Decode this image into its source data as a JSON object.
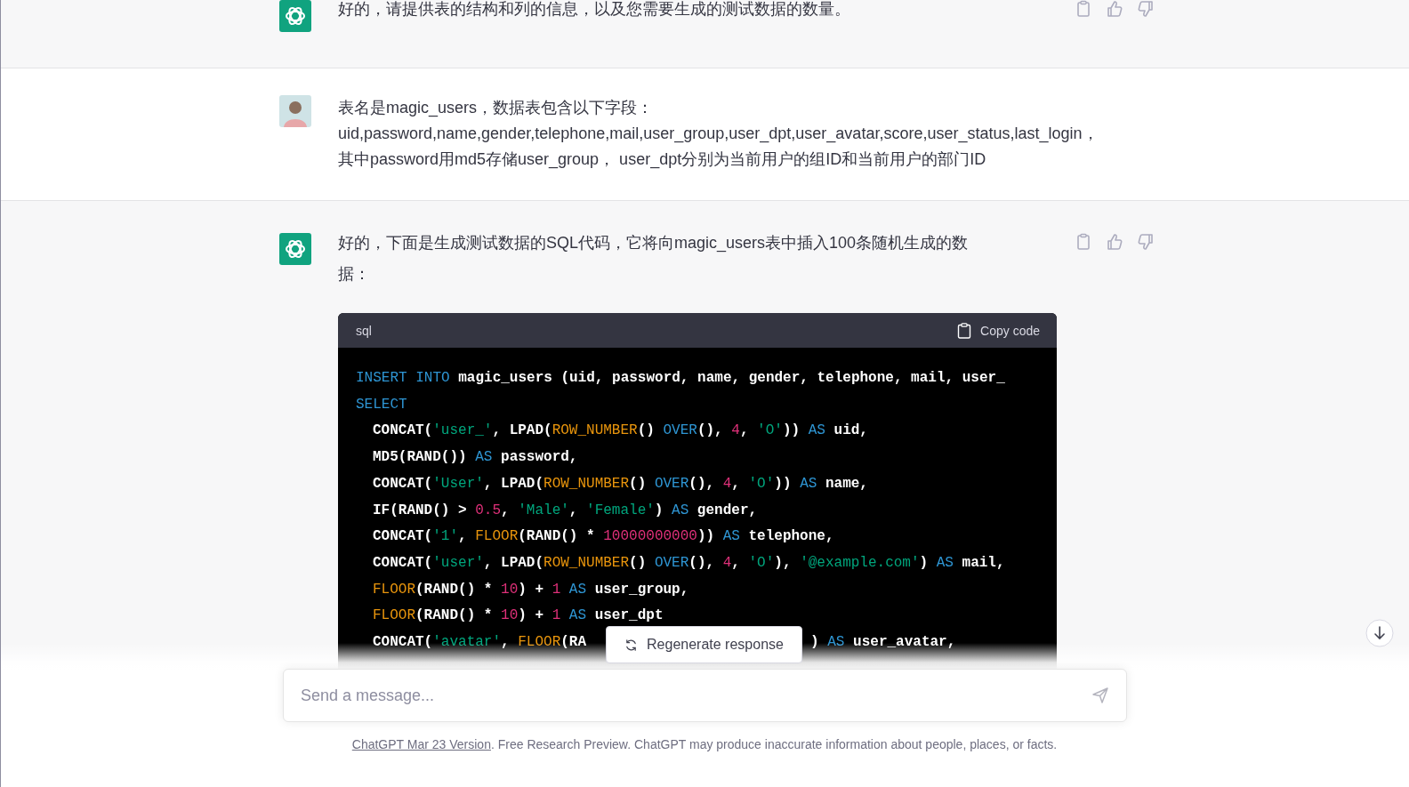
{
  "messages": [
    {
      "kind": "assistant",
      "lines": [
        "好的，请提供表的结构和列的信息，以及您需要生成的测试数据的数量。"
      ]
    },
    {
      "kind": "user",
      "lines": [
        "表名是magic_users，数据表包含以下字段：",
        "uid,password,name,gender,telephone,mail,user_group,user_dpt,user_avatar,score,user_status,last_login，",
        "其中password用md5存储user_group， user_dpt分别为当前用户的组ID和当前用户的部门ID"
      ]
    },
    {
      "kind": "assistant",
      "lines": [
        "好的，下面是生成测试数据的SQL代码，它将向magic_users表中插入100条随机生成的数据："
      ],
      "code": {
        "language": "sql",
        "copy_label": "Copy code",
        "lines": [
          {
            "indent": false,
            "tokens": [
              {
                "kind": "kw",
                "t": "INSERT INTO"
              },
              {
                "kind": "plain",
                "t": " magic_users (uid, password, name, gender, telephone, mail, user_"
              }
            ]
          },
          {
            "indent": false,
            "tokens": [
              {
                "kind": "kw",
                "t": "SELECT"
              }
            ]
          },
          {
            "indent": true,
            "tokens": [
              {
                "kind": "plain",
                "t": "CONCAT("
              },
              {
                "kind": "str",
                "t": "'user_'"
              },
              {
                "kind": "plain",
                "t": ", LPAD("
              },
              {
                "kind": "fn",
                "t": "ROW_NUMBER"
              },
              {
                "kind": "plain",
                "t": "() "
              },
              {
                "kind": "kw",
                "t": "OVER"
              },
              {
                "kind": "plain",
                "t": "(), "
              },
              {
                "kind": "num",
                "t": "4"
              },
              {
                "kind": "plain",
                "t": ", "
              },
              {
                "kind": "str",
                "t": "'O'"
              },
              {
                "kind": "plain",
                "t": ")) "
              },
              {
                "kind": "kw",
                "t": "AS"
              },
              {
                "kind": "plain",
                "t": " uid,"
              }
            ]
          },
          {
            "indent": true,
            "tokens": [
              {
                "kind": "plain",
                "t": "MD5(RAND()) "
              },
              {
                "kind": "kw",
                "t": "AS"
              },
              {
                "kind": "plain",
                "t": " password,"
              }
            ]
          },
          {
            "indent": true,
            "tokens": [
              {
                "kind": "plain",
                "t": "CONCAT("
              },
              {
                "kind": "str",
                "t": "'User'"
              },
              {
                "kind": "plain",
                "t": ", LPAD("
              },
              {
                "kind": "fn",
                "t": "ROW_NUMBER"
              },
              {
                "kind": "plain",
                "t": "() "
              },
              {
                "kind": "kw",
                "t": "OVER"
              },
              {
                "kind": "plain",
                "t": "(), "
              },
              {
                "kind": "num",
                "t": "4"
              },
              {
                "kind": "plain",
                "t": ", "
              },
              {
                "kind": "str",
                "t": "'O'"
              },
              {
                "kind": "plain",
                "t": ")) "
              },
              {
                "kind": "kw",
                "t": "AS"
              },
              {
                "kind": "plain",
                "t": " name,"
              }
            ]
          },
          {
            "indent": true,
            "tokens": [
              {
                "kind": "plain",
                "t": "IF(RAND() > "
              },
              {
                "kind": "num",
                "t": "0.5"
              },
              {
                "kind": "plain",
                "t": ", "
              },
              {
                "kind": "str",
                "t": "'Male'"
              },
              {
                "kind": "plain",
                "t": ", "
              },
              {
                "kind": "str",
                "t": "'Female'"
              },
              {
                "kind": "plain",
                "t": ") "
              },
              {
                "kind": "kw",
                "t": "AS"
              },
              {
                "kind": "plain",
                "t": " gender,"
              }
            ]
          },
          {
            "indent": true,
            "tokens": [
              {
                "kind": "plain",
                "t": "CONCAT("
              },
              {
                "kind": "str",
                "t": "'1'"
              },
              {
                "kind": "plain",
                "t": ", "
              },
              {
                "kind": "fn",
                "t": "FLOOR"
              },
              {
                "kind": "plain",
                "t": "(RAND() * "
              },
              {
                "kind": "num",
                "t": "10000000000"
              },
              {
                "kind": "plain",
                "t": ")) "
              },
              {
                "kind": "kw",
                "t": "AS"
              },
              {
                "kind": "plain",
                "t": " telephone,"
              }
            ]
          },
          {
            "indent": true,
            "tokens": [
              {
                "kind": "plain",
                "t": "CONCAT("
              },
              {
                "kind": "str",
                "t": "'user'"
              },
              {
                "kind": "plain",
                "t": ", LPAD("
              },
              {
                "kind": "fn",
                "t": "ROW_NUMBER"
              },
              {
                "kind": "plain",
                "t": "() "
              },
              {
                "kind": "kw",
                "t": "OVER"
              },
              {
                "kind": "plain",
                "t": "(), "
              },
              {
                "kind": "num",
                "t": "4"
              },
              {
                "kind": "plain",
                "t": ", "
              },
              {
                "kind": "str",
                "t": "'O'"
              },
              {
                "kind": "plain",
                "t": "), "
              },
              {
                "kind": "str",
                "t": "'@example.com'"
              },
              {
                "kind": "plain",
                "t": ") "
              },
              {
                "kind": "kw",
                "t": "AS"
              },
              {
                "kind": "plain",
                "t": " mail,"
              }
            ]
          },
          {
            "indent": true,
            "tokens": [
              {
                "kind": "fn",
                "t": "FLOOR"
              },
              {
                "kind": "plain",
                "t": "(RAND() * "
              },
              {
                "kind": "num",
                "t": "10"
              },
              {
                "kind": "plain",
                "t": ") + "
              },
              {
                "kind": "num",
                "t": "1"
              },
              {
                "kind": "kw",
                "t": " AS"
              },
              {
                "kind": "plain",
                "t": " user_group,"
              }
            ]
          },
          {
            "indent": true,
            "tokens": [
              {
                "kind": "fn",
                "t": "FLOOR"
              },
              {
                "kind": "plain",
                "t": "(RAND() * "
              },
              {
                "kind": "num",
                "t": "10"
              },
              {
                "kind": "plain",
                "t": ") + "
              },
              {
                "kind": "num",
                "t": "1"
              },
              {
                "kind": "kw",
                "t": " AS"
              },
              {
                "kind": "plain",
                "t": " user_dpt"
              }
            ]
          },
          {
            "indent": true,
            "tokens": [
              {
                "kind": "plain",
                "t": "CONCAT("
              },
              {
                "kind": "str",
                "t": "'avatar'"
              },
              {
                "kind": "plain",
                "t": ", "
              },
              {
                "kind": "fn",
                "t": "FLOOR"
              },
              {
                "kind": "plain",
                "t": "(RA"
              },
              {
                "kind": "gap"
              },
              {
                "kind": "plain",
                "t": ") "
              },
              {
                "kind": "kw",
                "t": "AS"
              },
              {
                "kind": "plain",
                "t": " user_avatar,"
              }
            ]
          }
        ]
      }
    }
  ],
  "regenerate": {
    "label": "Regenerate response"
  },
  "composer": {
    "placeholder": "Send a message..."
  },
  "footer": {
    "link": "ChatGPT Mar 23 Version",
    "text": ". Free Research Preview. ChatGPT may produce inaccurate information about people, places, or facts."
  }
}
